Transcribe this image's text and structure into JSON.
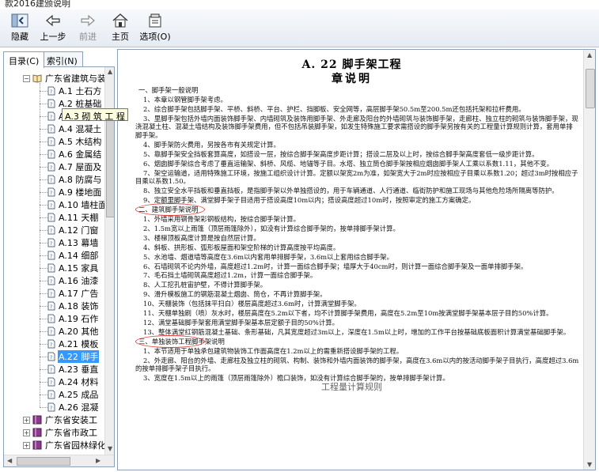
{
  "window": {
    "title_partial": "款2016建颁说明"
  },
  "toolbar": {
    "hide": "隐藏",
    "back": "上一步",
    "forward": "前进",
    "home": "主页",
    "options": "选项(O)"
  },
  "tabs": {
    "contents": "目录(C)",
    "index": "索引(N)"
  },
  "tree": {
    "root": "广东省建筑与装",
    "items": [
      "A.1  土石方",
      "A.2  桩基础",
      "A.3  砌  筑",
      "A.4  混凝土",
      "A.5  木结构",
      "A.6  金属结",
      "A.7  屋面及",
      "A.8  防腐与",
      "A.9  楼地面",
      "A.10  墙柱面",
      "A.11  天棚",
      "A.12  门窗",
      "A.13  幕墙",
      "A.14  细部",
      "A.15  家具",
      "A.16  油漆",
      "A.17  广告",
      "A.18  装饰",
      "A.19  石作",
      "A.20  其他",
      "A.21  模板",
      "A.22  脚手",
      "A.23  垂直",
      "A.24  材料",
      "A.25  成品",
      "A.26  混凝"
    ],
    "selected_index": 21,
    "books": [
      "广东省安装工",
      "广东省市政工",
      "广东省园林绿化"
    ],
    "tooltip": "A.3  砌  筑  工  程"
  },
  "document": {
    "title": "A. 22   脚手架工程",
    "subtitle": "章说明",
    "paragraphs": [
      {
        "level": 1,
        "text": "一、脚手架一般说明"
      },
      {
        "level": 2,
        "text": "1、本章以钢管脚手架考虑。"
      },
      {
        "level": 2,
        "text": "2、综合脚手架包括脚手架、平桥、斜桥、平台、护栏、挡脚板、安全网等，高层脚手架50.5m至200.5m还包括托架和拉杆费用。"
      },
      {
        "level": 2,
        "text": "3、里脚手架包括外墙内面装饰脚手架、内墙砌筑及装饰用脚手架、外走廊及阳台的外墙砌筑与装饰脚手架，走廊柱、独立柱的砌筑与装饰脚手架，现浇混凝土柱、混凝土墙结构及装饰脚手架费用，但不包括吊装脚手架，如发生特殊施工要求需搭设的脚手架另按有关的工程量计算规则计算，套用单排脚手架。"
      },
      {
        "level": 2,
        "text": "4、脚手架防火费用，另按各市有关规定计算。"
      },
      {
        "level": 2,
        "text": "5、靠脚手架安全挡板套算高度，如搭设一层，按综合脚手架高度步距计算；搭设二层及以上时，按综合脚手架高度套低一级步距计算。"
      },
      {
        "level": 2,
        "text": "6、烟囱脚手架综合考虑了垂直运输架、斜桥、风缆、地锚等子目。水塔、独立筒仓脚手架按相应烟囱脚手架人工乘以系数1.11，其他不变。"
      },
      {
        "level": 2,
        "text": "7、架空运输道，适用特殊施工环境，按施工组织设计计算。定额以架宽2m为准，如架宽大于2m时应按相应子目乘以系数1.20；超过3m时按相应子目乘以系数1.50。"
      },
      {
        "level": 2,
        "text": "8、独立安全水平挡板和垂直挡板，是指脚手架以外单独搭设的，用于车辆通道、人行通道、临街防护和施工现场与其他危险场所隔离等防护。"
      },
      {
        "level": 2,
        "text": "9、定额里脚手架、满堂脚手架子目适用于搭设高度10m以内；搭设高度超过10m时，按照审定的施工方案确定。"
      },
      {
        "level": 1,
        "text": "二、建筑脚手架说明"
      },
      {
        "level": 2,
        "text": "1、外墙采用钢骨架彩钢板结构，按综合脚手架计算。"
      },
      {
        "level": 2,
        "text": "2、1.5m宽以上雨篷（顶层雨篷除外），如没有计算综合脚手架的，按单排脚手架计算。"
      },
      {
        "level": 2,
        "text": "3、楼梯顶板高度计算是按自然层计算。"
      },
      {
        "level": 2,
        "text": "4、斜板、拱形板、弧形板屋面和架空阶梯的计算高度按平均高度。"
      },
      {
        "level": 2,
        "text": "5、水池墙、烟道墙等高度在3.6m以内套用单排脚手架，3.6m以上套用综合脚手架。"
      },
      {
        "level": 2,
        "text": "6、石墙砌筑不论内外墙，高度超过1.2m时，计算一面综合脚手架；墙厚大于40cm时，则计算一面综合脚手架及一面单排脚手架。"
      },
      {
        "level": 2,
        "text": "7、毛石挡土墙砌筑高度超过1.2m，计算一面综合脚手架。"
      },
      {
        "level": 2,
        "text": "8、人工挖孔桩宙护壁，不得计算脚手架。"
      },
      {
        "level": 2,
        "text": "9、滑升模板施工的钢筋混凝土烟囱、筒仓，不再计算脚手架。"
      },
      {
        "level": 2,
        "text": "10、天棚装饰（包括抹平扫白）楼层高度超过3.6m时，计算满堂脚手架。"
      },
      {
        "level": 2,
        "text": "11、天棚单独刷（喷）灰水时，楼层高度在5.2m以下者，均不计算脚手架费用，高度在5.2m至10m按满堂脚手架基本层子目的50%计算。"
      },
      {
        "level": 2,
        "text": "12、满堂基础脚手架套用满堂脚手架基本层定额子目的50%计算。"
      },
      {
        "level": 2,
        "text": "13、整体满堂红钢筋混凝土基础、条形基础，凡其宽度超过3m以上，深度在1.5m以上时，增加的工作平台按基础底板面积计算满堂基础脚手架。"
      },
      {
        "level": 1,
        "text": "三、单独装饰工程脚手架说明"
      },
      {
        "level": 2,
        "text": "1、本节适用于单独承包建筑物装饰工作面高度在1.2m以上的需重新搭设脚手架的工程。"
      },
      {
        "level": 2,
        "text": "2、外走廊、阳台的外墙、走廊柱及独立柱的砌筑、构制、装饰和外墙内面装饰的脚手架，高度在3.6m以内的按活动脚手架子目执行，高度超过3.6m的按单排脚手架子目执行。"
      },
      {
        "level": 2,
        "text": "3、宽度在1.5m以上的雨篷（顶层雨篷除外）檐口装饰，如没有计算综合脚手架的，按单排脚手架计算。"
      },
      {
        "level": 1,
        "text": "工程量计算规则"
      }
    ]
  },
  "colors": {
    "annotation": "#e0403a",
    "selection": "#3399ff",
    "tooltip_bg": "#ffffe1"
  }
}
